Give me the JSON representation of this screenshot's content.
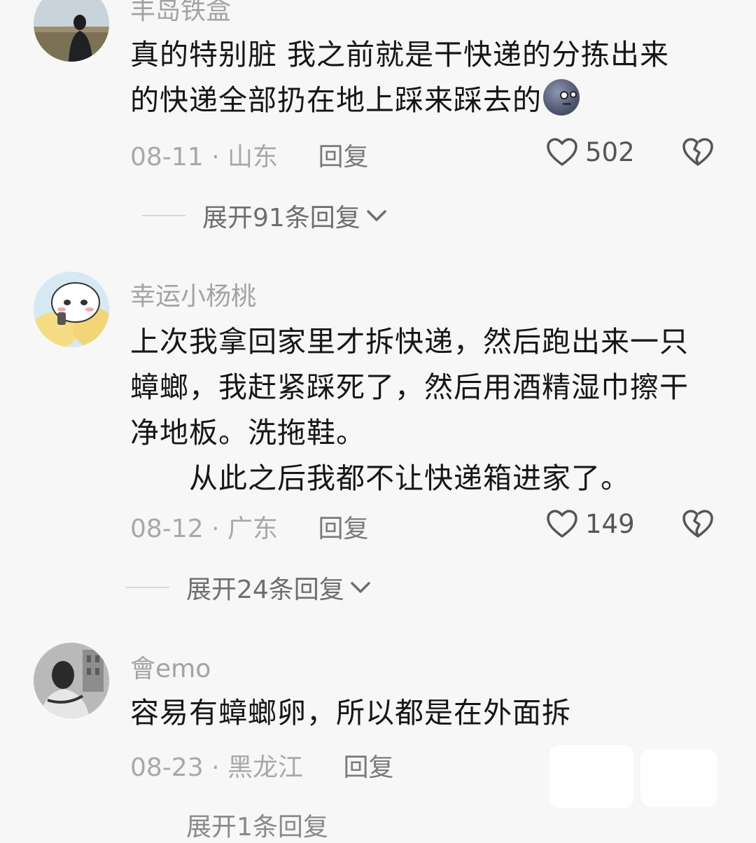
{
  "comments": [
    {
      "username": "丰岛铁盒",
      "lines": [
        "真的特别脏  我之前就是干快递的分拣出来",
        "的快递全部扔在地上踩来踩去的"
      ],
      "emoji": "new-moon-face-emoji",
      "date": "08-11",
      "location": "山东",
      "reply_label": "回复",
      "likes": "502",
      "expand_label": "展开91条回复"
    },
    {
      "username": "幸运小杨桃",
      "lines": [
        "上次我拿回家里才拆快递，然后跑出来一只",
        "蟑螂，我赶紧踩死了，然后用酒精湿巾擦干",
        "净地板。洗拖鞋。",
        "从此之后我都不让快递箱进家了。"
      ],
      "date": "08-12",
      "location": "广东",
      "reply_label": "回复",
      "likes": "149",
      "expand_label": "展开24条回复"
    },
    {
      "username": "會emo",
      "lines": [
        "容易有蟑螂卵，所以都是在外面拆"
      ],
      "date": "08-23",
      "location": "黑龙江",
      "reply_label": "回复",
      "expand_label": "展开1条回复"
    }
  ],
  "separator": "·",
  "icons": {
    "like": "heart-outline-icon",
    "dislike": "broken-heart-icon",
    "expand": "chevron-down-icon"
  },
  "colors": {
    "background": "#f7f7f7",
    "text": "#161616",
    "muted": "#a8a8a8"
  }
}
